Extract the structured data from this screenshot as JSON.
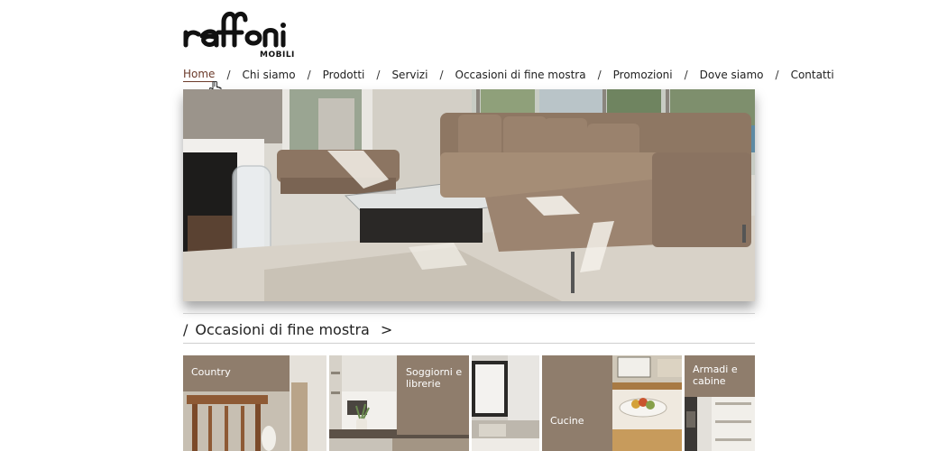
{
  "brand": {
    "logo_text": "raffoni",
    "subtitle": "MOBILI"
  },
  "nav": {
    "items": [
      {
        "label": "Home",
        "active": true
      },
      {
        "label": "Chi siamo"
      },
      {
        "label": "Prodotti"
      },
      {
        "label": "Servizi"
      },
      {
        "label": "Occasioni di fine mostra"
      },
      {
        "label": "Promozioni"
      },
      {
        "label": "Dove siamo"
      },
      {
        "label": "Contatti"
      }
    ],
    "separator": "/"
  },
  "hero": {
    "icon": "living-room-photo"
  },
  "section": {
    "slash": "/",
    "title": "Occasioni di fine mostra",
    "arrow": ">"
  },
  "tiles": [
    {
      "label": "Country"
    },
    {
      "label": "Soggiorni e librerie"
    },
    {
      "label": ""
    },
    {
      "label": "Cucine"
    },
    {
      "label": "Armadi e cabine"
    }
  ],
  "colors": {
    "accent": "#6b3a2a",
    "tile_overlay": "#8f7d6c",
    "rule": "#cfcfcf"
  }
}
